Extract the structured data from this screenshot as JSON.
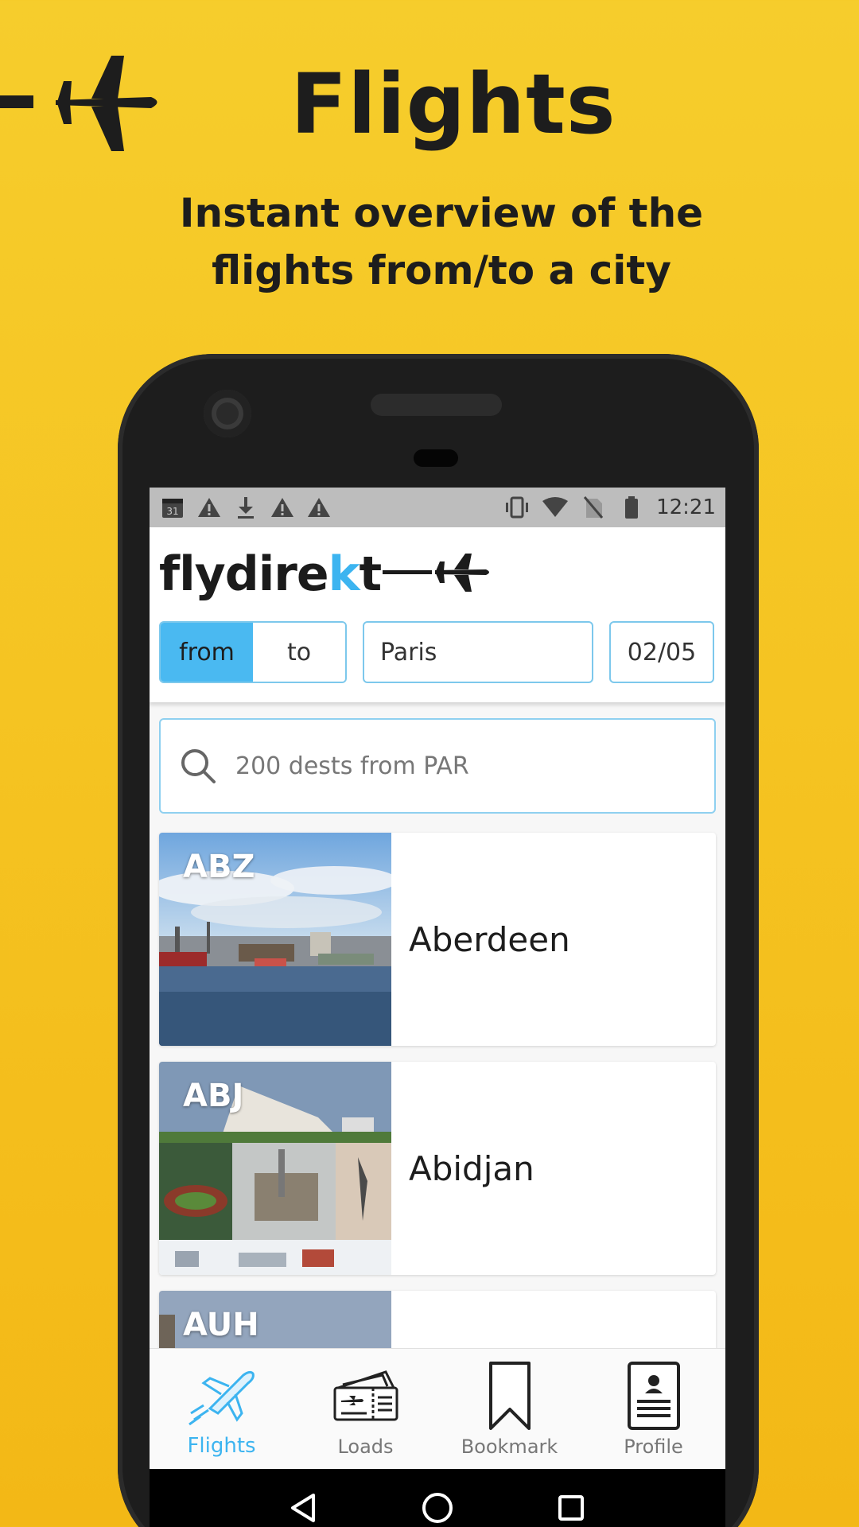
{
  "promo": {
    "title": "Flights",
    "subtitle_line1": "Instant overview of the",
    "subtitle_line2": "flights from/to a city"
  },
  "statusbar": {
    "time": "12:21",
    "left_icons": [
      "calendar-icon",
      "warning-icon",
      "download-icon",
      "warning-icon",
      "warning-icon"
    ],
    "calendar_day": "31",
    "right_icons": [
      "vibrate-icon",
      "wifi-icon",
      "no-sim-icon",
      "battery-icon"
    ]
  },
  "app": {
    "logo_prefix": "flydire",
    "logo_k": "k",
    "logo_suffix": "t",
    "toggle": {
      "from_label": "from",
      "to_label": "to",
      "selected": "from"
    },
    "city_value": "Paris",
    "date_value": "02/05",
    "search_placeholder": "200 dests from PAR"
  },
  "destinations": [
    {
      "code": "ABZ",
      "name": "Aberdeen"
    },
    {
      "code": "ABJ",
      "name": "Abidjan"
    },
    {
      "code": "AUH",
      "name": ""
    }
  ],
  "bottom_nav": [
    {
      "label": "Flights",
      "icon": "plane-icon",
      "active": true
    },
    {
      "label": "Loads",
      "icon": "ticket-icon",
      "active": false
    },
    {
      "label": "Bookmark",
      "icon": "bookmark-icon",
      "active": false
    },
    {
      "label": "Profile",
      "icon": "profile-icon",
      "active": false
    }
  ],
  "colors": {
    "background": "#f5c321",
    "accent": "#3cb4f0",
    "toggle_active": "#4ab9f1",
    "text_dark": "#1d1d1d"
  }
}
